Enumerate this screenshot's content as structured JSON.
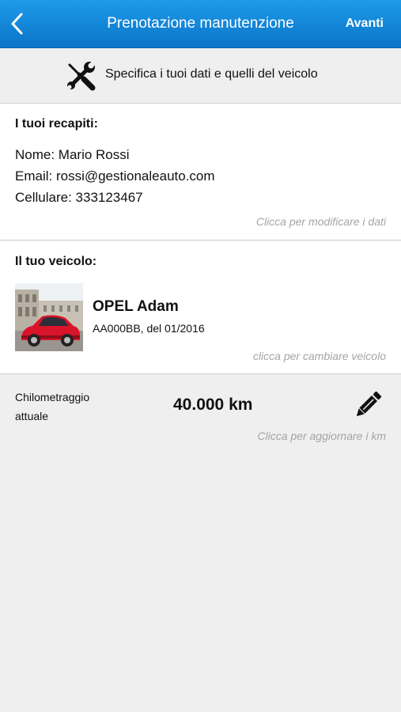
{
  "header": {
    "back_icon": "chevron-left-icon",
    "title": "Prenotazione manutenzione",
    "next_label": "Avanti",
    "accent_color": "#1288dd"
  },
  "spec": {
    "icon": "tools-icon",
    "text": "Specifica i tuoi dati e quelli del veicolo"
  },
  "contacts": {
    "title": "I tuoi recapiti:",
    "lines": [
      "Nome: Mario Rossi",
      "Email: rossi@gestionaleauto.com",
      "Cellulare: 333123467"
    ],
    "hint": "Clicca per modificare i dati"
  },
  "vehicle": {
    "title": "Il tuo veicolo:",
    "name": "OPEL Adam",
    "plate": "AA000BB, del 01/2016",
    "hint": "clicca per cambiare veicolo",
    "image_icon": "car-photo"
  },
  "mileage": {
    "label": "Chilometraggio attuale",
    "value": "40.000 km",
    "edit_icon": "pencil-icon",
    "hint": "Clicca per aggiornare i km"
  }
}
